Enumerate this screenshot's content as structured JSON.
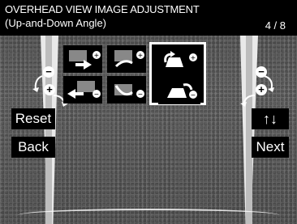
{
  "header": {
    "title_line1": "OVERHEAD VIEW IMAGE ADJUSTMENT",
    "title_line2": "(Up-and-Down Angle)",
    "page": "4 / 8"
  },
  "buttons": {
    "reset": "Reset",
    "back": "Back",
    "updown": "↑↓",
    "next": "Next"
  },
  "indicators": {
    "minus": "−",
    "plus": "+"
  },
  "icons": [
    "front-move-plus-icon",
    "side-move-plus-icon",
    "selected-rotate-plus-icon",
    "front-move-minus-icon",
    "side-move-minus-icon",
    "selected-rotate-minus-icon"
  ]
}
